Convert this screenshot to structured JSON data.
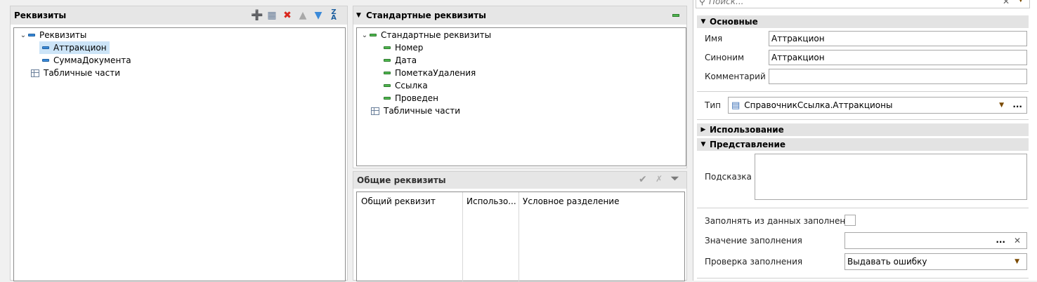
{
  "left": {
    "title": "Реквизиты",
    "tree": [
      {
        "label": "Реквизиты"
      },
      {
        "label": "Аттракцион"
      },
      {
        "label": "СуммаДокумента"
      },
      {
        "label": "Табличные части"
      }
    ]
  },
  "middle_top": {
    "title": "Стандартные реквизиты",
    "tree": [
      {
        "label": "Стандартные реквизиты"
      },
      {
        "label": "Номер"
      },
      {
        "label": "Дата"
      },
      {
        "label": "ПометкаУдаления"
      },
      {
        "label": "Ссылка"
      },
      {
        "label": "Проведен"
      },
      {
        "label": "Табличные части"
      }
    ]
  },
  "middle_bottom": {
    "title": "Общие реквизиты",
    "columns": [
      "Общий реквизит",
      "Использо...",
      "Условное разделение"
    ]
  },
  "props": {
    "search_placeholder": "Поиск...",
    "sections": {
      "main": "Основные",
      "usage": "Использование",
      "presentation": "Представление"
    },
    "name_label": "Имя",
    "name_value": "Аттракцион",
    "synonym_label": "Синоним",
    "synonym_value": "Аттракцион",
    "comment_label": "Комментарий",
    "comment_value": "",
    "type_label": "Тип",
    "type_value": "СправочникСсылка.Аттракционы",
    "ellipsis": "...",
    "hint_label": "Подсказка",
    "fill_from_label": "Заполнять из данных заполнения",
    "fill_value_label": "Значение заполнения",
    "fill_check_label": "Проверка заполнения",
    "fill_check_value": "Выдавать ошибку"
  }
}
